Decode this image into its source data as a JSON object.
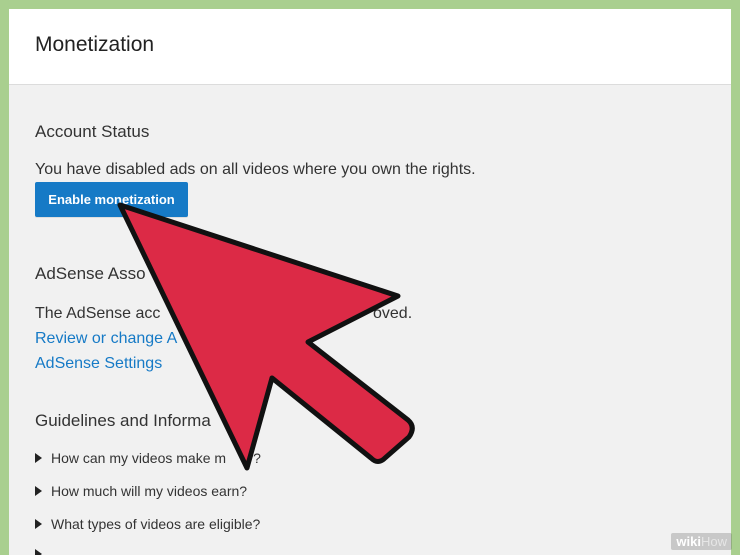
{
  "header": {
    "title": "Monetization"
  },
  "account_status": {
    "title": "Account Status",
    "message": "You have disabled ads on all videos where you own the rights.",
    "enable_button": "Enable monetization"
  },
  "adsense": {
    "title": "AdSense Asso",
    "message_start": "The AdSense acc",
    "message_end": "oved.",
    "review_link": "Review or change A",
    "settings_link": "AdSense Settings"
  },
  "guidelines": {
    "title": "Guidelines and Informa",
    "items": [
      {
        "label": "How can my videos make m",
        "label_tail": "y?"
      },
      {
        "label": "How much will my videos earn?"
      },
      {
        "label": "What types of videos are eligible?"
      }
    ]
  },
  "watermark": {
    "part1": "wiki",
    "part2": "How"
  },
  "colors": {
    "accent": "#167ac6",
    "arrow_fill": "#dc2a46",
    "border_green": "#a9cf8f"
  }
}
